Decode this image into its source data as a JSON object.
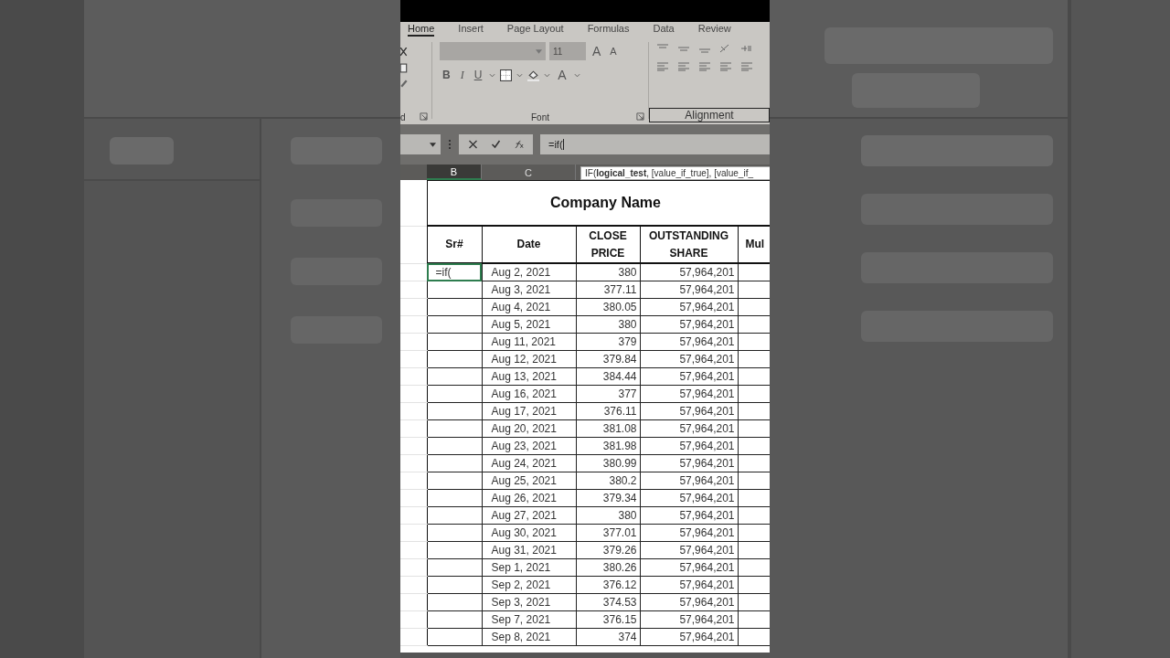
{
  "ribbon": {
    "tabs": [
      {
        "label": "Home",
        "selected": true
      },
      {
        "label": "Insert",
        "selected": false
      },
      {
        "label": "Page Layout",
        "selected": false
      },
      {
        "label": "Formulas",
        "selected": false
      },
      {
        "label": "Data",
        "selected": false
      },
      {
        "label": "Review",
        "selected": false
      }
    ],
    "font_size": "11",
    "grow_font": "A",
    "shrink_font": "A",
    "format_buttons": [
      "B",
      "I",
      "U"
    ],
    "font_color": "A",
    "groups": [
      "d",
      "Font",
      "Alignment"
    ]
  },
  "formula_bar": {
    "value": "=if("
  },
  "column_headers": [
    {
      "label": "B",
      "selected": true
    },
    {
      "label": "C",
      "selected": false
    }
  ],
  "tooltip": "IF(**logical_test**, [value_if_true], [value_if_",
  "sheet": {
    "title": "Company Name",
    "headers": [
      "Sr#",
      "Date",
      "CLOSE PRICE",
      "OUTSTANDING SHARE",
      "Mul"
    ],
    "rows": [
      {
        "sr": "=if(",
        "date": "Aug 2, 2021",
        "close": "380",
        "shares": "57,964,201",
        "selected": true
      },
      {
        "sr": "",
        "date": "Aug 3, 2021",
        "close": "377.11",
        "shares": "57,964,201",
        "selected": false
      },
      {
        "sr": "",
        "date": "Aug 4, 2021",
        "close": "380.05",
        "shares": "57,964,201",
        "selected": false
      },
      {
        "sr": "",
        "date": "Aug 5, 2021",
        "close": "380",
        "shares": "57,964,201",
        "selected": false
      },
      {
        "sr": "",
        "date": "Aug 11, 2021",
        "close": "379",
        "shares": "57,964,201",
        "selected": false
      },
      {
        "sr": "",
        "date": "Aug 12, 2021",
        "close": "379.84",
        "shares": "57,964,201",
        "selected": false
      },
      {
        "sr": "",
        "date": "Aug 13, 2021",
        "close": "384.44",
        "shares": "57,964,201",
        "selected": false
      },
      {
        "sr": "",
        "date": "Aug 16, 2021",
        "close": "377",
        "shares": "57,964,201",
        "selected": false
      },
      {
        "sr": "",
        "date": "Aug 17, 2021",
        "close": "376.11",
        "shares": "57,964,201",
        "selected": false
      },
      {
        "sr": "",
        "date": "Aug 20, 2021",
        "close": "381.08",
        "shares": "57,964,201",
        "selected": false
      },
      {
        "sr": "",
        "date": "Aug 23, 2021",
        "close": "381.98",
        "shares": "57,964,201",
        "selected": false
      },
      {
        "sr": "",
        "date": "Aug 24, 2021",
        "close": "380.99",
        "shares": "57,964,201",
        "selected": false
      },
      {
        "sr": "",
        "date": "Aug 25, 2021",
        "close": "380.2",
        "shares": "57,964,201",
        "selected": false
      },
      {
        "sr": "",
        "date": "Aug 26, 2021",
        "close": "379.34",
        "shares": "57,964,201",
        "selected": false
      },
      {
        "sr": "",
        "date": "Aug 27, 2021",
        "close": "380",
        "shares": "57,964,201",
        "selected": false
      },
      {
        "sr": "",
        "date": "Aug 30, 2021",
        "close": "377.01",
        "shares": "57,964,201",
        "selected": false
      },
      {
        "sr": "",
        "date": "Aug 31, 2021",
        "close": "379.26",
        "shares": "57,964,201",
        "selected": false
      },
      {
        "sr": "",
        "date": "Sep 1, 2021",
        "close": "380.26",
        "shares": "57,964,201",
        "selected": false
      },
      {
        "sr": "",
        "date": "Sep 2, 2021",
        "close": "376.12",
        "shares": "57,964,201",
        "selected": false
      },
      {
        "sr": "",
        "date": "Sep 3, 2021",
        "close": "374.53",
        "shares": "57,964,201",
        "selected": false
      },
      {
        "sr": "",
        "date": "Sep 7, 2021",
        "close": "376.15",
        "shares": "57,964,201",
        "selected": false
      },
      {
        "sr": "",
        "date": "Sep 8, 2021",
        "close": "374",
        "shares": "57,964,201",
        "selected": false
      }
    ]
  }
}
